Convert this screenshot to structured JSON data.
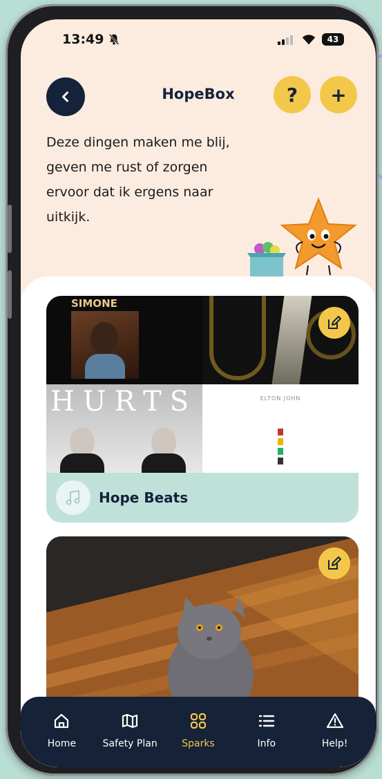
{
  "status": {
    "time": "13:49",
    "battery": "43"
  },
  "header": {
    "title": "HopeBox",
    "help_label": "?",
    "add_label": "+"
  },
  "intro_text": "Deze dingen maken me blij, geven me rust of zorgen ervoor dat ik ergens naar uitkijk.",
  "cards": [
    {
      "label": "Hope Beats",
      "album_texts": {
        "simone": "SIMONE",
        "hurts": "HURTS",
        "elton": "ELTON JOHN"
      }
    },
    {
      "label": ""
    }
  ],
  "tabs": [
    {
      "label": "Home",
      "icon": "home-icon"
    },
    {
      "label": "Safety Plan",
      "icon": "map-icon"
    },
    {
      "label": "Sparks",
      "icon": "grid-icon",
      "active": true
    },
    {
      "label": "Info",
      "icon": "list-icon"
    },
    {
      "label": "Help!",
      "icon": "warning-icon"
    }
  ],
  "colors": {
    "navy": "#14223a",
    "yellow": "#f3c84a",
    "mint": "#c0e1da",
    "cream": "#fcece0",
    "background": "#b9ded3"
  }
}
